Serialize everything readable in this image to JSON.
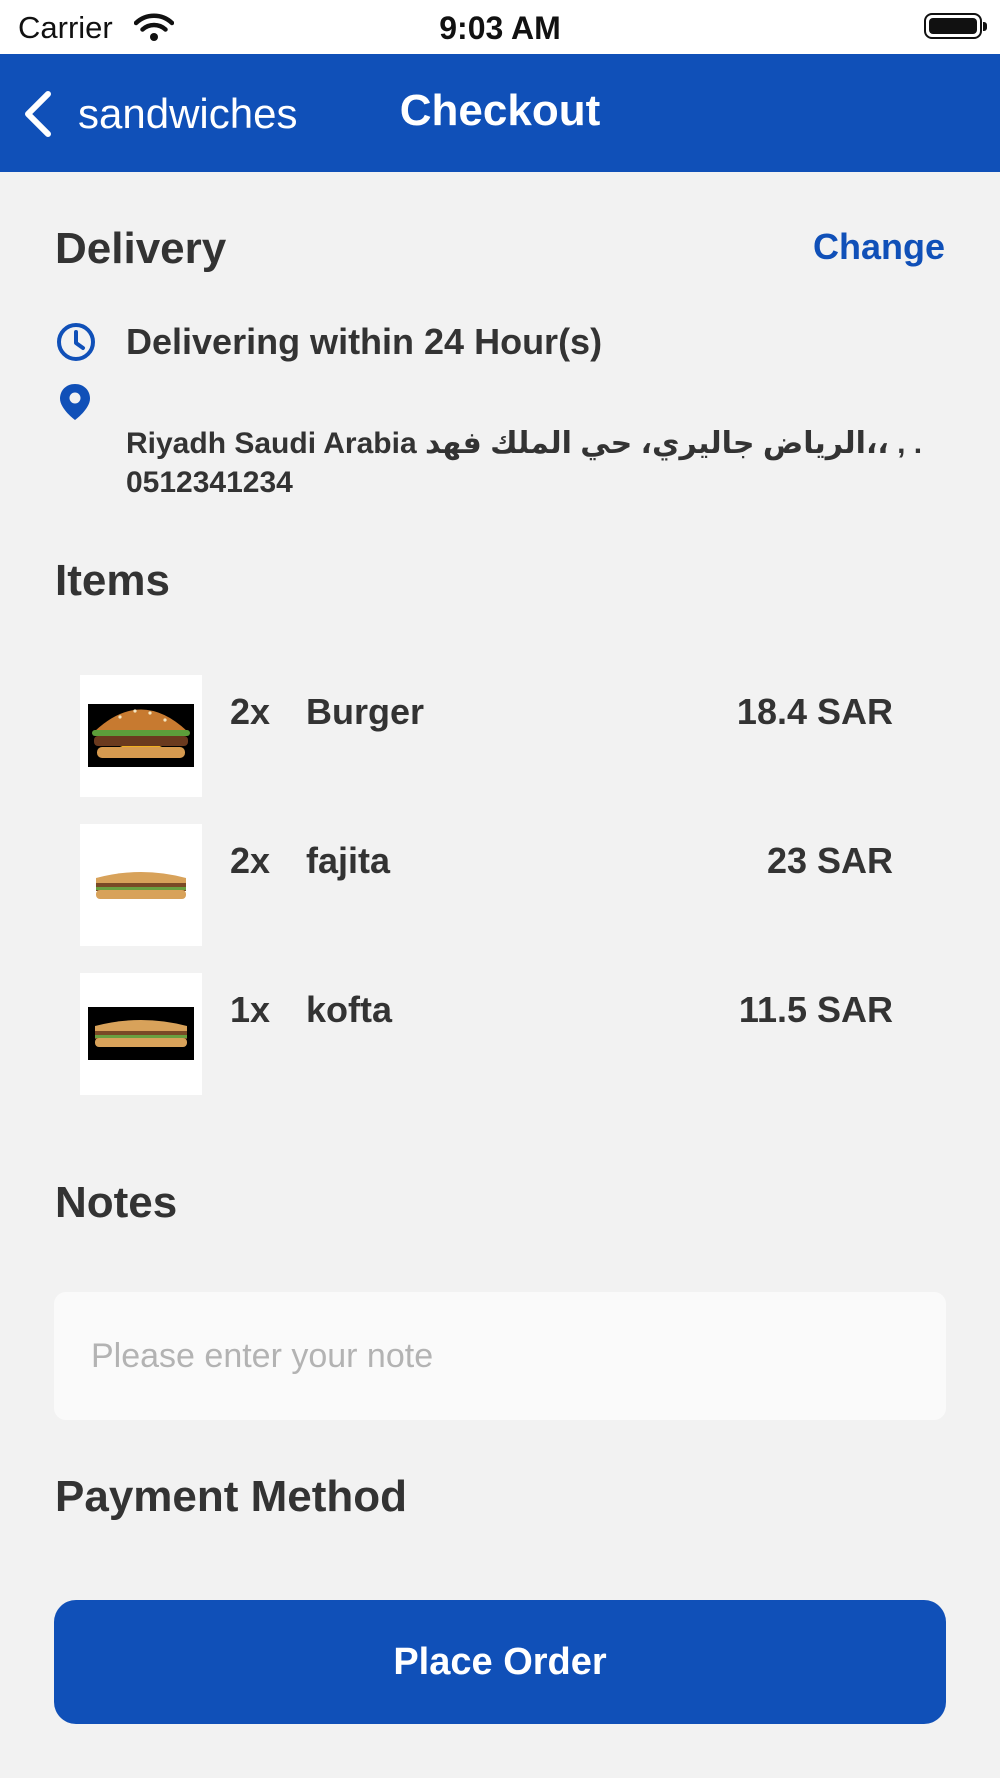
{
  "status_bar": {
    "carrier": "Carrier",
    "time": "9:03 AM"
  },
  "nav": {
    "back_label": "sandwiches",
    "title": "Checkout"
  },
  "delivery": {
    "title": "Delivery",
    "change_label": "Change",
    "time_text": "Delivering within 24 Hour(s)",
    "address_line": "Riyadh Saudi Arabia الرياض جاليري، حي الملك فهد،، , .",
    "phone": "0512341234"
  },
  "items": {
    "title": "Items",
    "list": [
      {
        "qty": "2x",
        "name": "Burger",
        "price": "18.4 SAR",
        "image": "burger"
      },
      {
        "qty": "2x",
        "name": "fajita",
        "price": "23 SAR",
        "image": "fajita-sandwich"
      },
      {
        "qty": "1x",
        "name": "kofta",
        "price": "11.5 SAR",
        "image": "kofta-sandwich"
      }
    ]
  },
  "notes": {
    "title": "Notes",
    "placeholder": "Please enter your note",
    "value": ""
  },
  "payment": {
    "title": "Payment Method"
  },
  "place_order_label": "Place Order",
  "colors": {
    "primary": "#1050b8",
    "background": "#f2f2f2",
    "text": "#333333"
  }
}
